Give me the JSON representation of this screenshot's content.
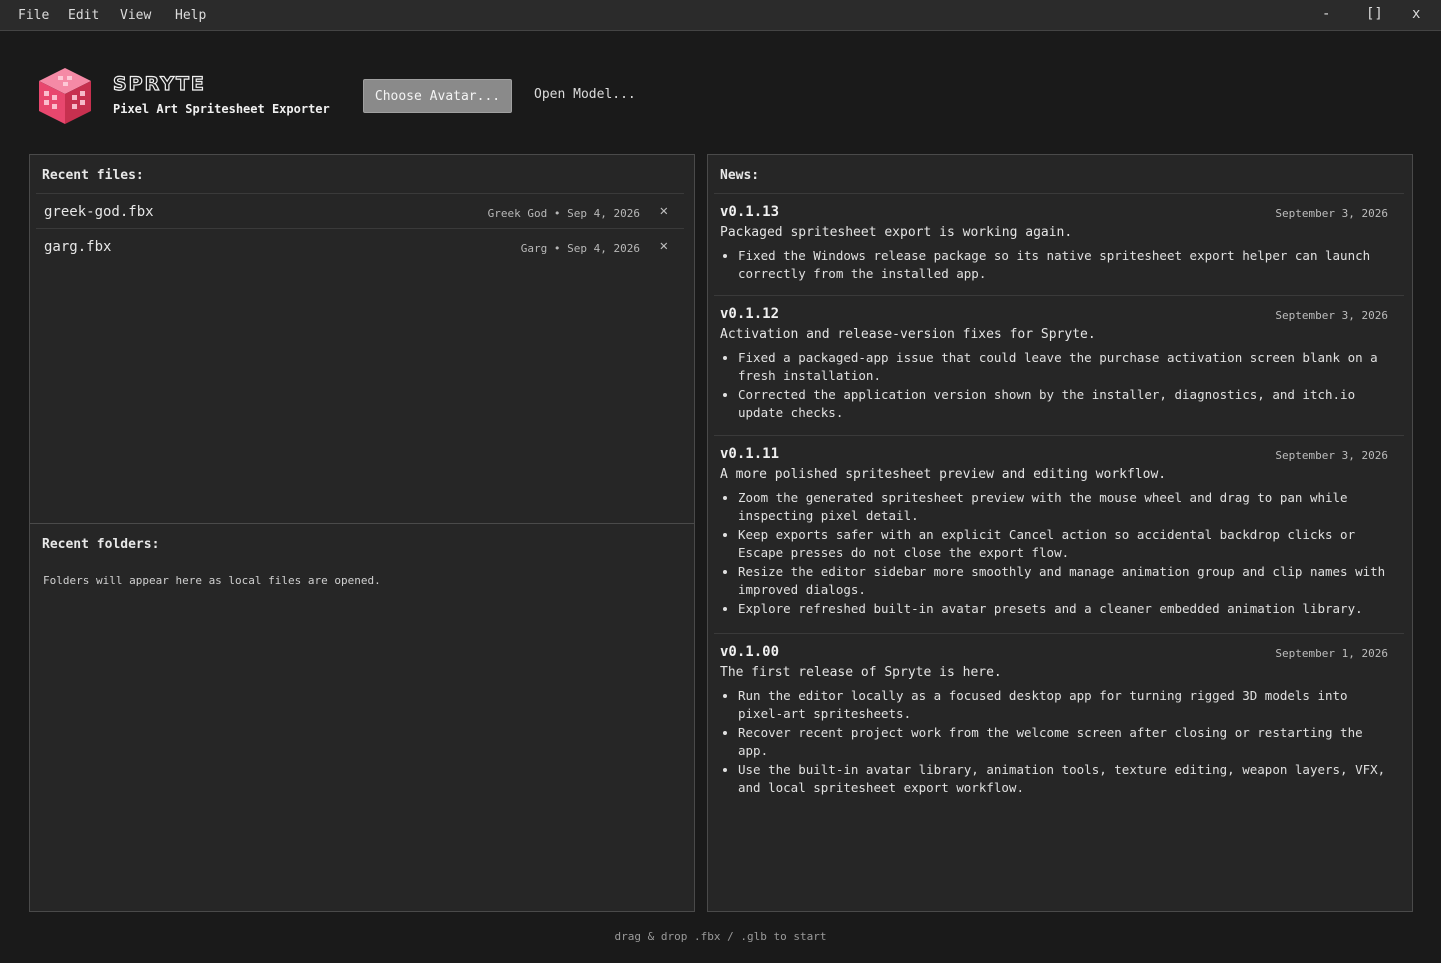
{
  "menu": [
    "File",
    "Edit",
    "View",
    "Help"
  ],
  "window_controls": {
    "minimize": "-",
    "maximize": "[]",
    "close": "x"
  },
  "brand": {
    "title": "SPRYTE",
    "subtitle": "Pixel Art Spritesheet Exporter",
    "logo_icon": "pink-cube-logo-icon",
    "accent": "#e8476e"
  },
  "actions": {
    "choose_avatar": "Choose Avatar...",
    "open_model": "Open Model..."
  },
  "recent_files": {
    "title": "Recent files:",
    "items": [
      {
        "name": "greek-god.fbx",
        "meta": "Greek God • Sep 4, 2026",
        "remove": "✕"
      },
      {
        "name": "garg.fbx",
        "meta": "Garg • Sep 4, 2026",
        "remove": "✕"
      }
    ]
  },
  "recent_folders": {
    "title": "Recent folders:",
    "empty": "Folders will appear here as local files are opened."
  },
  "news": {
    "title": "News:",
    "entries": [
      {
        "version": "v0.1.13",
        "date": "September 3, 2026",
        "summary": "Packaged spritesheet export is working again.",
        "items": [
          "Fixed the Windows release package so its native spritesheet export helper can launch correctly from the installed app."
        ]
      },
      {
        "version": "v0.1.12",
        "date": "September 3, 2026",
        "summary": "Activation and release-version fixes for Spryte.",
        "items": [
          "Fixed a packaged-app issue that could leave the purchase activation screen blank on a fresh installation.",
          "Corrected the application version shown by the installer, diagnostics, and itch.io update checks."
        ]
      },
      {
        "version": "v0.1.11",
        "date": "September 3, 2026",
        "summary": "A more polished spritesheet preview and editing workflow.",
        "items": [
          "Zoom the generated spritesheet preview with the mouse wheel and drag to pan while inspecting pixel detail.",
          "Keep exports safer with an explicit Cancel action so accidental backdrop clicks or Escape presses do not close the export flow.",
          "Resize the editor sidebar more smoothly and manage animation group and clip names with improved dialogs.",
          "Explore refreshed built-in avatar presets and a cleaner embedded animation library."
        ]
      },
      {
        "version": "v0.1.00",
        "date": "September 1, 2026",
        "summary": "The first release of Spryte is here.",
        "items": [
          "Run the editor locally as a focused desktop app for turning rigged 3D models into pixel-art spritesheets.",
          "Recover recent project work from the welcome screen after closing or restarting the app.",
          "Use the built-in avatar library, animation tools, texture editing, weapon layers, VFX, and local spritesheet export workflow."
        ]
      }
    ]
  },
  "footer": "drag & drop .fbx / .glb to start"
}
